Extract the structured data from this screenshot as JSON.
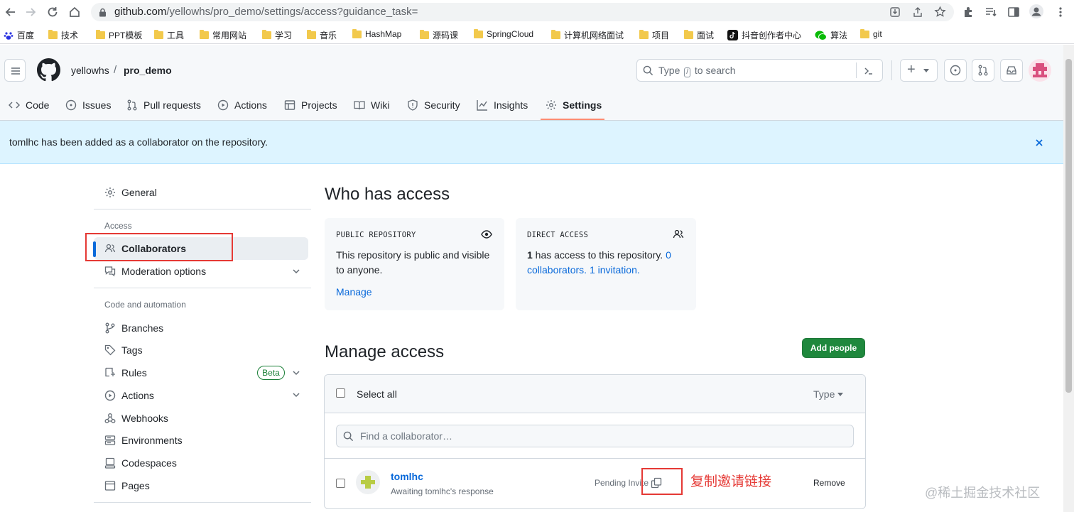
{
  "browser": {
    "url_host": "github.com",
    "url_path": "/yellowhs/pro_demo/settings/access?guidance_task=",
    "bookmarks": [
      "百度",
      "技术",
      "PPT模板",
      "工具",
      "常用网站",
      "学习",
      "音乐",
      "HashMap",
      "源码课",
      "SpringCloud",
      "计算机网络面试",
      "项目",
      "面试",
      "抖音创作者中心",
      "算法",
      "git"
    ]
  },
  "header": {
    "owner": "yellowhs",
    "separator": "/",
    "repo": "pro_demo",
    "search_pre": "Type",
    "search_key": "/",
    "search_post": "to search",
    "plus": "+"
  },
  "tabs": [
    {
      "label": "Code",
      "icon": "code-icon"
    },
    {
      "label": "Issues",
      "icon": "issue-icon"
    },
    {
      "label": "Pull requests",
      "icon": "pull-request-icon"
    },
    {
      "label": "Actions",
      "icon": "play-icon"
    },
    {
      "label": "Projects",
      "icon": "table-icon"
    },
    {
      "label": "Wiki",
      "icon": "book-icon"
    },
    {
      "label": "Security",
      "icon": "shield-icon"
    },
    {
      "label": "Insights",
      "icon": "graph-icon"
    },
    {
      "label": "Settings",
      "icon": "gear-icon",
      "selected": true
    }
  ],
  "flash": {
    "message": "tomlhc has been added as a collaborator on the repository."
  },
  "sidebar": {
    "general": "General",
    "access_heading": "Access",
    "collaborators": "Collaborators",
    "moderation": "Moderation options",
    "code_heading": "Code and automation",
    "branches": "Branches",
    "tags": "Tags",
    "rules": "Rules",
    "beta": "Beta",
    "actions": "Actions",
    "webhooks": "Webhooks",
    "environments": "Environments",
    "codespaces": "Codespaces",
    "pages": "Pages"
  },
  "who_has_access": {
    "title": "Who has access",
    "public": {
      "label": "PUBLIC REPOSITORY",
      "line1": "This repository is public and visible",
      "line2": "to anyone.",
      "manage": "Manage"
    },
    "direct": {
      "label": "DIRECT ACCESS",
      "count": "1",
      "text1": " has access to this repository. ",
      "collab_count": "0",
      "collab_word": "collaborators",
      "dot1": ". ",
      "invitation": "1 invitation",
      "dot2": "."
    }
  },
  "manage_access": {
    "title": "Manage access",
    "add_people": "Add people",
    "select_all": "Select all",
    "type_filter": "Type",
    "find_placeholder": "Find a collaborator…",
    "rows": [
      {
        "name": "tomlhc",
        "subtitle": "Awaiting tomlhc's response",
        "status": "Pending Invite",
        "action": "Remove"
      }
    ]
  },
  "annotation": "复制邀请链接",
  "watermark": "@稀土掘金技术社区",
  "colors": {
    "accent": "#0969da",
    "primary_button": "#1f883d",
    "flash_bg": "#ddf4ff",
    "annotation": "#e53935",
    "selected_tab_underline": "#fd8c73"
  }
}
